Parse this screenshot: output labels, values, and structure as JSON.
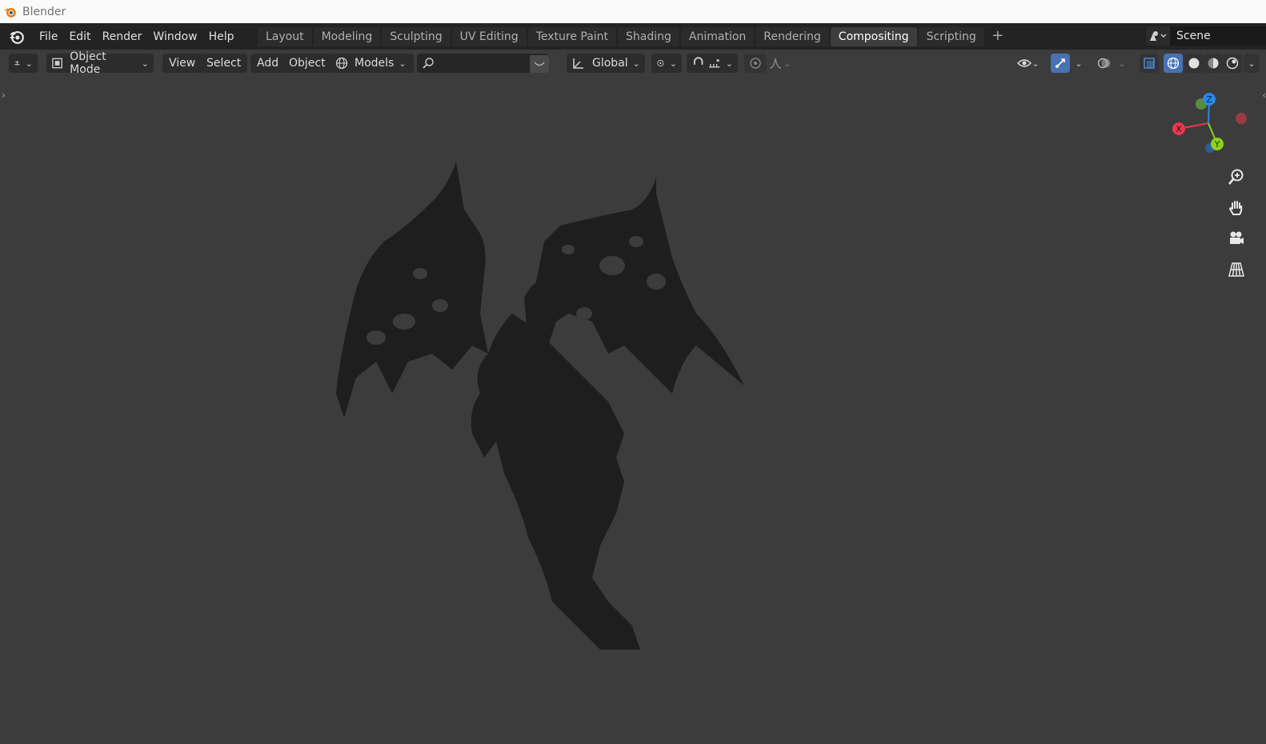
{
  "window": {
    "title": "Blender"
  },
  "menu": [
    "File",
    "Edit",
    "Render",
    "Window",
    "Help"
  ],
  "workspaces": {
    "tabs": [
      "Layout",
      "Modeling",
      "Sculpting",
      "UV Editing",
      "Texture Paint",
      "Shading",
      "Animation",
      "Rendering",
      "Compositing",
      "Scripting"
    ],
    "active": "Compositing",
    "add_label": "+"
  },
  "scene": {
    "name": "Scene"
  },
  "viewport_header": {
    "mode": "Object Mode",
    "view_menu": "View",
    "select_menu": "Select",
    "add_menu": "Add",
    "object_menu": "Object",
    "collection": "Models",
    "search_value": "",
    "orientation": "Global"
  },
  "gizmo_axes": {
    "x": "X",
    "y": "Y",
    "z": "Z"
  },
  "colors": {
    "accent": "#4772b3",
    "active_tab": "#3d3d3d",
    "viewport_bg": "#3c3c3c",
    "axis_x": "#e8394d",
    "axis_y": "#8bd11d",
    "axis_z": "#2b87e8"
  }
}
